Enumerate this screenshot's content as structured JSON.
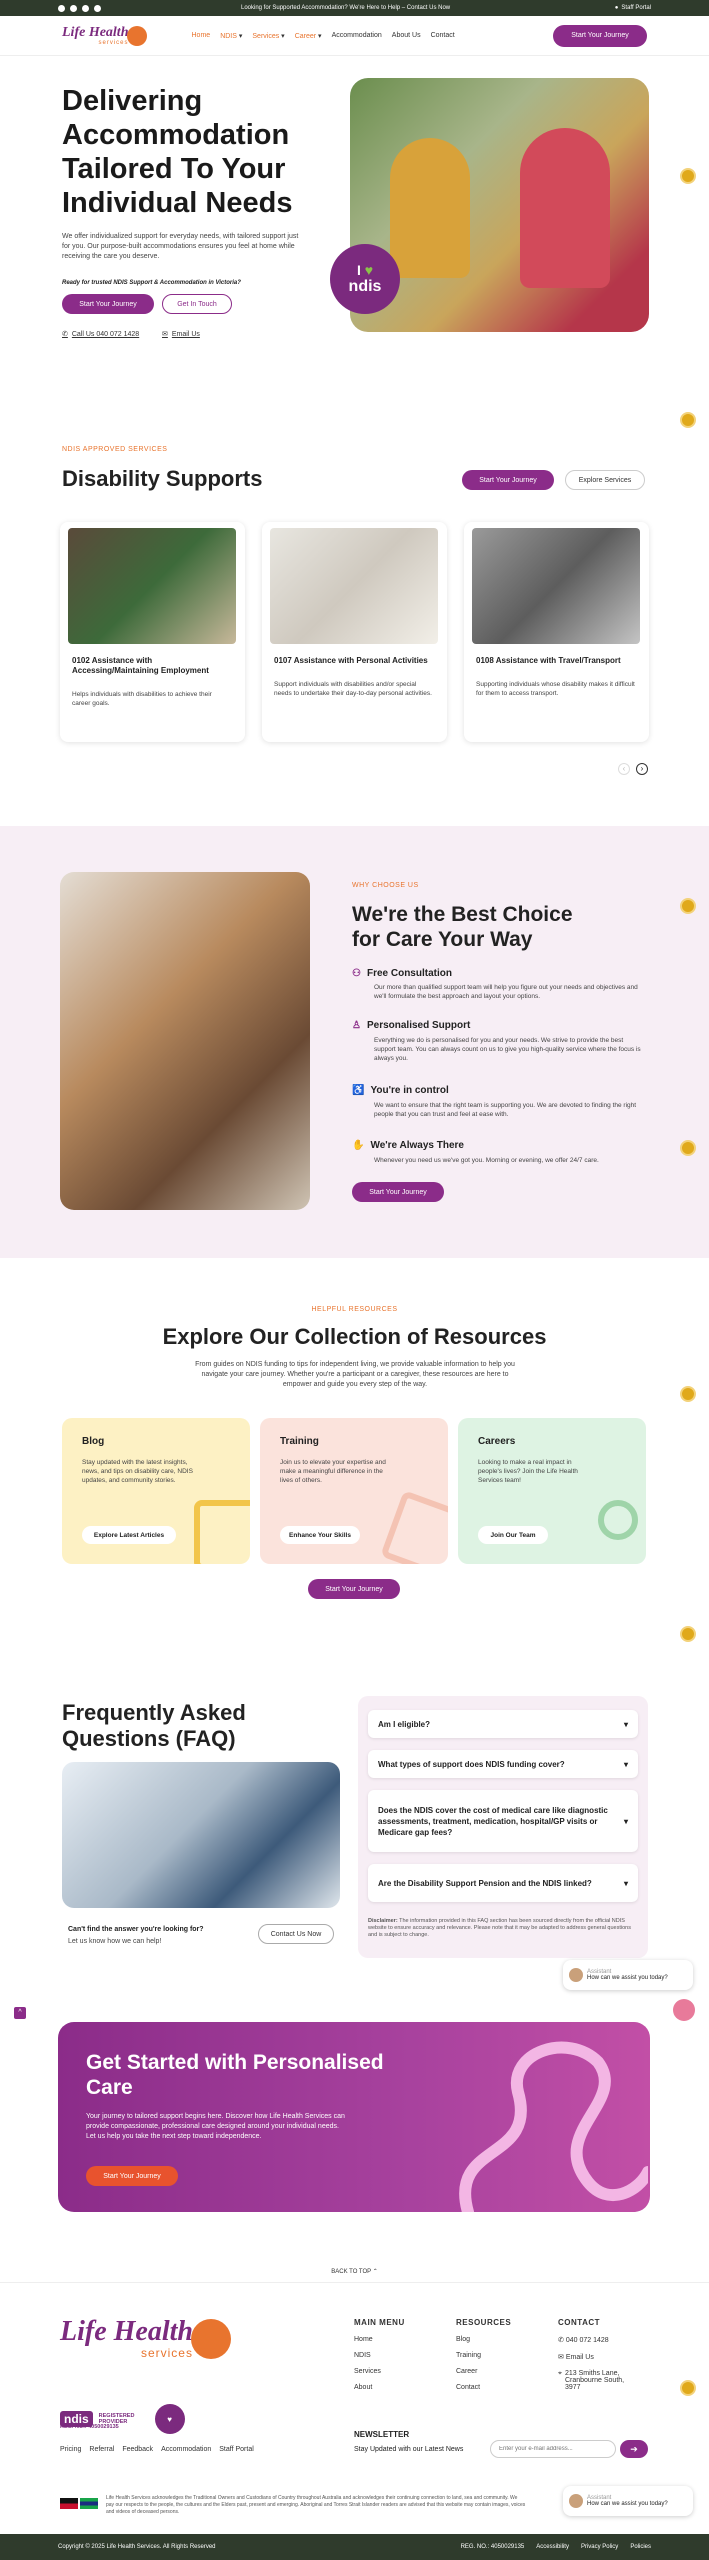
{
  "topbar": {
    "message": "Looking for Supported Accommodation? We're Here to Help – Contact Us Now",
    "staff_portal": "Staff Portal"
  },
  "nav": {
    "logo_text": "Life Health",
    "logo_sub": "services",
    "items": [
      "Home",
      "NDIS",
      "Services",
      "Career",
      "Accommodation",
      "About Us",
      "Contact"
    ],
    "cta": "Start Your Journey"
  },
  "hero": {
    "title": "Delivering Accommodation Tailored To Your Individual Needs",
    "paragraph": "We offer individualized support for everyday needs, with tailored support just for you. Our purpose-built accommodations ensures you feel at home while receiving the care you deserve.",
    "question": "Ready for trusted NDIS Support & Accommodation in Victoria?",
    "btn_primary": "Start Your Journey",
    "btn_secondary": "Get In Touch",
    "phone": "Call Us 040 072 1428",
    "email": "Email Us",
    "badge_text": "ndis",
    "badge_prefix": "I"
  },
  "supports": {
    "eyebrow": "NDIS APPROVED SERVICES",
    "title": "Disability Supports",
    "btn_primary": "Start Your Journey",
    "btn_secondary": "Explore Services",
    "cards": [
      {
        "title": "0102 Assistance with Accessing/Maintaining Employment",
        "desc": "Helps individuals with disabilities to achieve their career goals."
      },
      {
        "title": "0107 Assistance with Personal Activities",
        "desc": "Support individuals with disabilities and/or special needs to undertake their day-to-day personal activities."
      },
      {
        "title": "0108 Assistance with Travel/Transport",
        "desc": "Supporting individuals whose disability makes it difficult for them to access transport."
      }
    ]
  },
  "why": {
    "eyebrow": "WHY CHOOSE US",
    "title": "We're the Best Choice for Care Your Way",
    "features": [
      {
        "title": "Free Consultation",
        "desc": "Our more than qualified support team will help you figure out your needs and objectives and we'll formulate the best approach and layout your options."
      },
      {
        "title": "Personalised Support",
        "desc": "Everything we do is personalised for you and your needs. We strive to provide the best support team. You can always count on us to give you high-quality service where the focus is always you."
      },
      {
        "title": "You're in control",
        "desc": "We want to ensure that the right team is supporting you. We are devoted to finding the right people that you can trust and feel at ease with."
      },
      {
        "title": "We're Always There",
        "desc": "Whenever you need us we've got you. Morning or evening, we offer 24/7 care."
      }
    ],
    "cta": "Start Your Journey"
  },
  "resources": {
    "eyebrow": "HELPFUL RESOURCES",
    "title": "Explore Our Collection of Resources",
    "intro": "From guides on NDIS funding to tips for independent living, we provide valuable information to help you navigate your care journey. Whether you're a participant or a caregiver, these resources are here to empower and guide you every step of the way.",
    "cards": [
      {
        "title": "Blog",
        "desc": "Stay updated with the latest insights, news, and tips on disability care, NDIS updates, and community stories.",
        "btn": "Explore Latest Articles",
        "color": "#fdf1c4"
      },
      {
        "title": "Training",
        "desc": "Join us to elevate your expertise and make a meaningful difference in the lives of others.",
        "btn": "Enhance Your Skills",
        "color": "#fbe3dc"
      },
      {
        "title": "Careers",
        "desc": "Looking to make a real impact in people's lives? Join the Life Health Services team!",
        "btn": "Join Our Team",
        "color": "#def3e3"
      }
    ],
    "cta": "Start Your Journey"
  },
  "faq": {
    "title": "Frequently Asked Questions (FAQ)",
    "questions": [
      "Am I eligible?",
      "What types of support does NDIS funding cover?",
      "Does the NDIS cover the cost of medical care like diagnostic assessments, treatment, medication, hospital/GP visits or Medicare gap fees?",
      "Are the Disability Support Pension and the NDIS linked?"
    ],
    "cant_find": "Can't find the answer you're looking for?",
    "help": "Let us know how we can help!",
    "contact_btn": "Contact Us Now",
    "disclaimer_label": "Disclaimer:",
    "disclaimer": "The information provided in this FAQ section has been sourced directly from the official NDIS website to ensure accuracy and relevance. Please note that it may be adapted to address general questions and is subject to change."
  },
  "cta": {
    "title": "Get Started with Personalised Care",
    "desc": "Your journey to tailored support begins here. Discover how Life Health Services can provide compassionate, professional care designed around your individual needs. Let us help you take the next step toward independence.",
    "btn": "Start Your Journey"
  },
  "chat": {
    "name": "Assistant",
    "message": "How can we assist you today?"
  },
  "footer": {
    "back_to_top": "BACK TO TOP",
    "main_menu_title": "MAIN MENU",
    "main_menu": [
      "Home",
      "NDIS",
      "Services",
      "About"
    ],
    "resources_title": "RESOURCES",
    "resources": [
      "Blog",
      "Training",
      "Career",
      "Contact"
    ],
    "contact_title": "CONTACT",
    "phone": "040 072 1428",
    "email": "Email Us",
    "address": "213 Smiths Lane, Cranbourne South, 3977",
    "registered": "REGISTERED PROVIDER",
    "reg_no": "REG. NO.: 4050029135",
    "ndis_logo": "ndis",
    "links": [
      "Pricing",
      "Referral",
      "Feedback",
      "Accommodation",
      "Staff Portal"
    ],
    "newsletter_title": "NEWSLETTER",
    "newsletter_sub": "Stay Updated with our Latest News",
    "newsletter_placeholder": "Enter your e-mail address...",
    "acknowledgement": "Life Health Services acknowledges the Traditional Owners and Custodians of Country throughout Australia and acknowledges their continuing connection to land, sea and community. We pay our respects to the people, the cultures and the Elders past, present and emerging. Aboriginal and Torres Strait Islander readers are advised that this website may contain images, voices and videos of deceased persons.",
    "copyright": "Copyright © 2025 Life Health Services. All Rights Reserved",
    "reg_bottom": "REG. NO.: 4050029135",
    "bottom_links": [
      "Accessibility",
      "Privacy Policy",
      "Policies"
    ]
  }
}
